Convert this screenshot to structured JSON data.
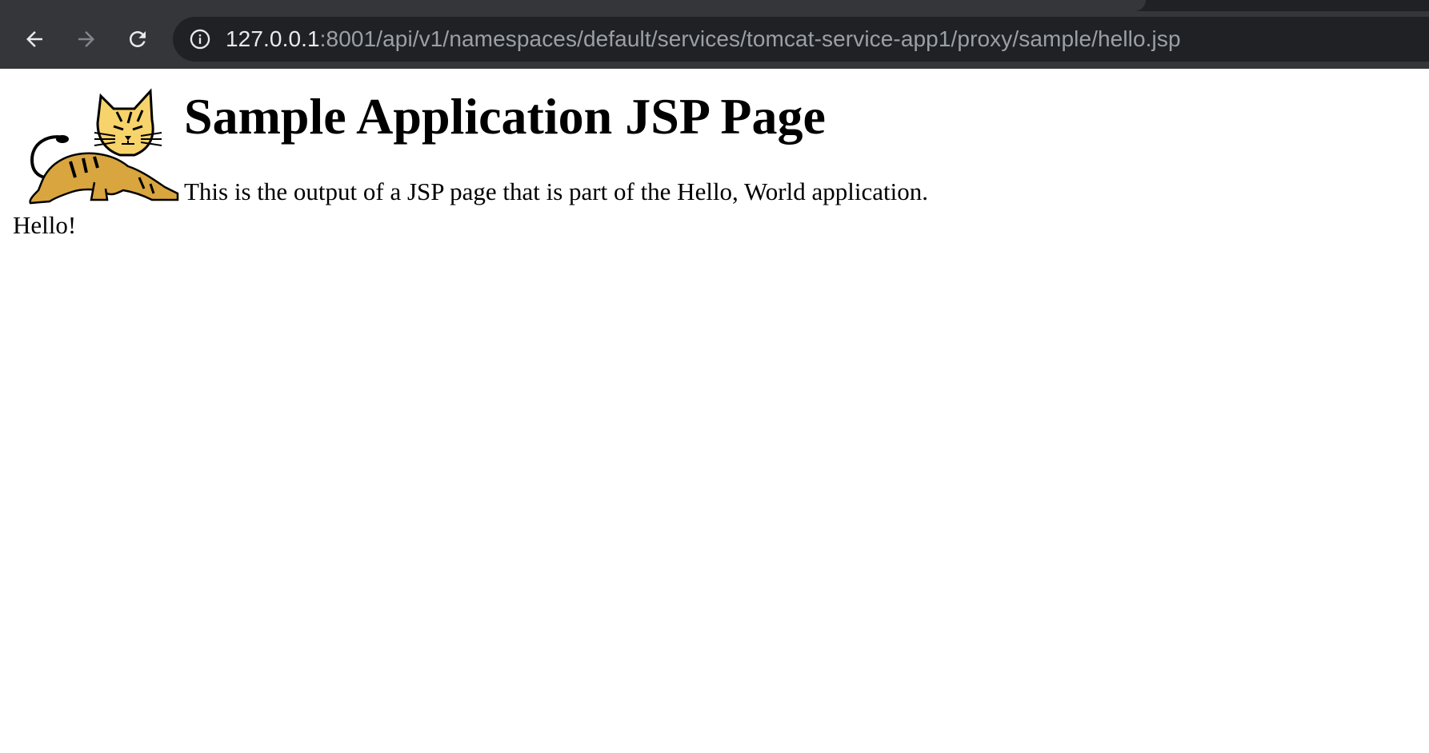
{
  "browser": {
    "address_bar": {
      "host": "127.0.0.1",
      "path": ":8001/api/v1/namespaces/default/services/tomcat-service-app1/proxy/sample/hello.jsp"
    },
    "icons": {
      "back": "back-arrow-icon",
      "forward": "forward-arrow-icon",
      "reload": "reload-icon",
      "site_info": "info-icon"
    },
    "colors": {
      "toolbar": "#35363a",
      "omnibox": "#202124",
      "host_text": "#e8eaed",
      "path_text": "#9aa0a6"
    }
  },
  "page": {
    "title": "Sample Application JSP Page",
    "intro": "This is the output of a JSP page that is part of the Hello, World application.",
    "greeting": "Hello!",
    "logo": "tomcat-cat-logo"
  }
}
